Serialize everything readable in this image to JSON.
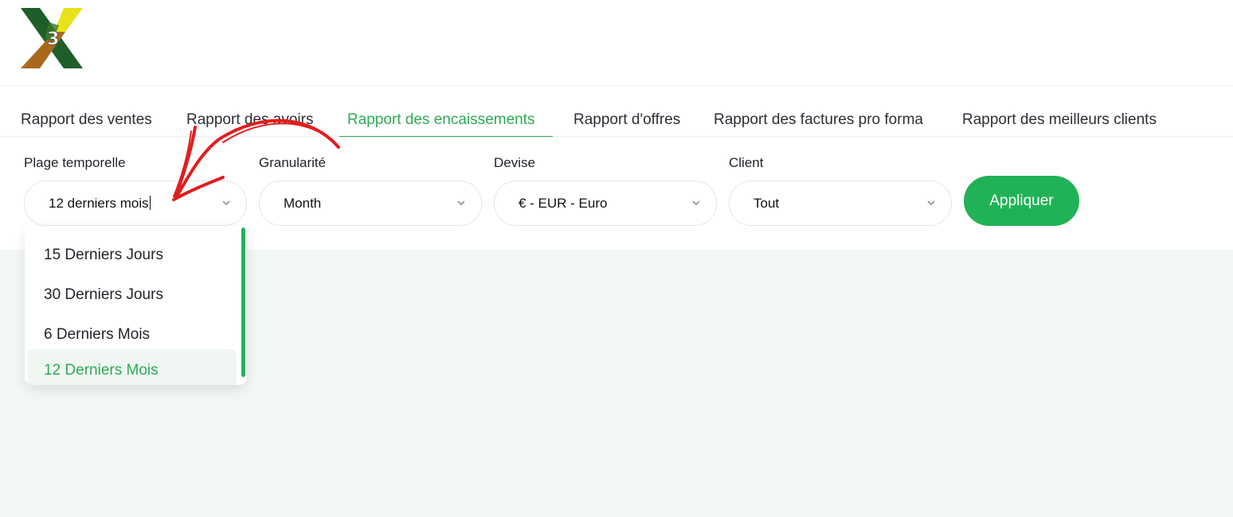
{
  "tabs": [
    {
      "label": "Rapport des ventes",
      "active": false
    },
    {
      "label": "Rapport des avoirs",
      "active": false
    },
    {
      "label": "Rapport des encaissements",
      "active": true
    },
    {
      "label": "Rapport d'offres",
      "active": false
    },
    {
      "label": "Rapport des factures pro forma",
      "active": false
    },
    {
      "label": "Rapport des meilleurs clients",
      "active": false
    }
  ],
  "filters": {
    "time_range": {
      "label": "Plage temporelle",
      "value": "12 derniers mois"
    },
    "granularity": {
      "label": "Granularité",
      "value": "Month"
    },
    "currency": {
      "label": "Devise",
      "value": "€ - EUR - Euro"
    },
    "client": {
      "label": "Client",
      "value": "Tout"
    }
  },
  "apply_label": "Appliquer",
  "time_range_options": [
    {
      "label": "15 Derniers Jours",
      "selected": false
    },
    {
      "label": "30 Derniers Jours",
      "selected": false
    },
    {
      "label": "6 Derniers Mois",
      "selected": false
    },
    {
      "label": "12 Derniers Mois",
      "selected": true
    }
  ],
  "colors": {
    "accent": "#21b257",
    "annotation": "#e01e1e",
    "content_bg": "#f3f8f4"
  },
  "icons": {
    "logo": "x3-logo-icon",
    "chevron": "chevron-down-icon",
    "annotation": "red-arrow-annotation"
  }
}
